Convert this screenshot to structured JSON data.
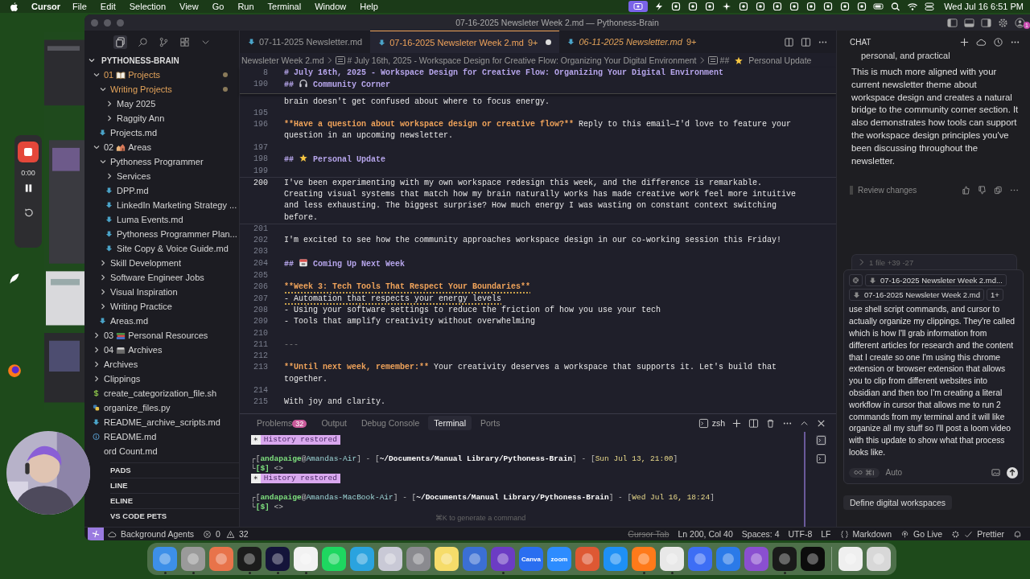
{
  "menu_bar": {
    "app": "Cursor",
    "items": [
      "File",
      "Edit",
      "Selection",
      "View",
      "Go",
      "Run",
      "Terminal",
      "Window",
      "Help"
    ],
    "clock": "Wed Jul 16  6:51 PM"
  },
  "recorder": {
    "time": "0:00"
  },
  "window": {
    "title": "07-16-2025 Newsleter Week 2.md — Pythoness-Brain",
    "notifications": "1"
  },
  "tabs": [
    {
      "label": "07-11-2025 Newsletter.md",
      "selected": false,
      "preview": false,
      "dirty": false
    },
    {
      "label": "07-16-2025 Newsleter Week 2.md",
      "selected": true,
      "preview": false,
      "problems": "9+",
      "dirty": true
    },
    {
      "label": "06-11-2025 Newsletter.md",
      "selected": false,
      "preview": true,
      "problems": "9+",
      "dirty": false
    }
  ],
  "explorer": {
    "title": "PYTHONESS-BRAIN",
    "tree": [
      {
        "kind": "folder",
        "prefix": "01",
        "emblem": {
          "kind": "book"
        },
        "label": "Projects",
        "expanded": true,
        "modified": true,
        "children": [
          {
            "kind": "folder",
            "label": "Writing Projects",
            "expanded": true,
            "modified": true,
            "children": [
              {
                "kind": "folder",
                "label": "May 2025",
                "expanded": false,
                "modified": false
              },
              {
                "kind": "folder",
                "label": "Raggity Ann",
                "expanded": false,
                "modified": false
              }
            ]
          },
          {
            "kind": "md",
            "label": "Projects.md",
            "modified": false
          }
        ]
      },
      {
        "kind": "folder",
        "prefix": "02",
        "emblem": {
          "kind": "houses"
        },
        "label": "Areas",
        "expanded": true,
        "modified": false,
        "children": [
          {
            "kind": "folder",
            "label": "Pythoness Programmer",
            "expanded": true,
            "modified": false,
            "children": [
              {
                "kind": "folder",
                "label": "Services",
                "expanded": false,
                "modified": false
              },
              {
                "kind": "md",
                "label": "DPP.md",
                "modified": false
              },
              {
                "kind": "md",
                "label": "LinkedIn Marketing Strategy ...",
                "modified": false
              },
              {
                "kind": "md",
                "label": "Luma Events.md",
                "modified": false
              },
              {
                "kind": "md",
                "label": "Pythoness Programmer Plan...",
                "modified": false
              },
              {
                "kind": "md",
                "label": "Site Copy & Voice Guide.md",
                "modified": false
              }
            ]
          },
          {
            "kind": "folder",
            "label": "Skill Development",
            "expanded": false,
            "modified": false
          },
          {
            "kind": "folder",
            "label": "Software Engineer Jobs",
            "expanded": false,
            "modified": false
          },
          {
            "kind": "folder",
            "label": "Visual Inspiration",
            "expanded": false,
            "modified": false
          },
          {
            "kind": "folder",
            "label": "Writing Practice",
            "expanded": false,
            "modified": false
          },
          {
            "kind": "md",
            "label": "Areas.md",
            "modified": false
          }
        ]
      },
      {
        "kind": "folder",
        "prefix": "03",
        "emblem": {
          "kind": "books"
        },
        "label": "Personal Resources",
        "expanded": false,
        "modified": false
      },
      {
        "kind": "folder",
        "prefix": "04",
        "emblem": {
          "kind": "cardbox"
        },
        "label": "Archives",
        "expanded": false,
        "modified": false
      },
      {
        "kind": "folder",
        "label": "Archives",
        "expanded": false,
        "modified": false
      },
      {
        "kind": "folder",
        "label": "Clippings",
        "expanded": false,
        "modified": false
      },
      {
        "kind": "sh",
        "label": "create_categorization_file.sh",
        "modified": false
      },
      {
        "kind": "py",
        "label": "organize_files.py",
        "modified": false
      },
      {
        "kind": "md",
        "label": "README_archive_scripts.md",
        "modified": false
      },
      {
        "kind": "info",
        "label": "README.md",
        "modified": false
      },
      {
        "kind": "plain",
        "label": "ord Count.md",
        "modified": false
      }
    ]
  },
  "sidebar_panels": [
    "PADS",
    "LINE",
    "ELINE",
    "VS CODE PETS"
  ],
  "breadcrumb": [
    {
      "kind": "file",
      "text": "Newsleter Week 2.md"
    },
    {
      "kind": "symbol",
      "text": "# July 16th, 2025 - Workspace Design for Creative Flow: Organizing Your Digital Environment"
    },
    {
      "kind": "symbol",
      "prefix": "##",
      "emblem": {
        "kind": "star"
      },
      "text": "Personal Update"
    }
  ],
  "editor": {
    "sticky": [
      {
        "number": "8",
        "segments": [
          {
            "kind": "heading",
            "text": "# July 16th, 2025 - Workspace Design for Creative Flow: Organizing Your Digital Environment"
          }
        ]
      },
      {
        "number": "190",
        "segments": [
          {
            "kind": "heading",
            "text": "##"
          },
          {
            "kind": "headphones"
          },
          {
            "kind": "heading",
            "text": "Community Corner"
          }
        ]
      }
    ],
    "lines": [
      {
        "current": false,
        "squiggle": false,
        "segments": [
          {
            "kind": "text",
            "text": "brain doesn't get confused about where to focus energy."
          }
        ]
      },
      {
        "number": "195",
        "current": false
      },
      {
        "number": "196",
        "current": false,
        "squiggle": false,
        "segments": [
          {
            "kind": "bold",
            "text": "**Have a question about workspace design or creative flow?**"
          },
          {
            "kind": "text",
            "text": " Reply to this email—I'd love to feature your question in an upcoming newsletter."
          }
        ]
      },
      {
        "number": "197",
        "current": false
      },
      {
        "number": "198",
        "current": false,
        "squiggle": false,
        "segments": [
          {
            "kind": "heading",
            "text": "##"
          },
          {
            "kind": "star"
          },
          {
            "kind": "heading",
            "text": "Personal Update"
          }
        ]
      },
      {
        "number": "199",
        "current": false
      },
      {
        "number": "200",
        "current": true,
        "squiggle": false,
        "segments": [
          {
            "kind": "text",
            "text": "I've been experimenting with my own workspace redesign this week, and the difference is remarkable. Creating visual systems that match how my brain naturally works has made creative work feel more intuitive and less exhausting. The biggest surprise? How much energy I was wasting on constant context switching before."
          }
        ]
      },
      {
        "number": "201",
        "current": false
      },
      {
        "number": "202",
        "current": false,
        "squiggle": false,
        "segments": [
          {
            "kind": "text",
            "text": "I'm excited to see how the community approaches workspace design in our co-working session this Friday!"
          }
        ]
      },
      {
        "number": "203",
        "current": false
      },
      {
        "number": "204",
        "current": false,
        "squiggle": false,
        "segments": [
          {
            "kind": "heading",
            "text": "##"
          },
          {
            "kind": "calendar"
          },
          {
            "kind": "heading",
            "text": "Coming Up Next Week"
          }
        ]
      },
      {
        "number": "205",
        "current": false
      },
      {
        "number": "206",
        "current": false,
        "squiggle": true,
        "segments": [
          {
            "kind": "bold",
            "text": "**Week 3: Tech Tools That Respect Your Boundaries**"
          }
        ]
      },
      {
        "number": "207",
        "current": false,
        "squiggle": true,
        "segments": [
          {
            "kind": "text",
            "text": "- Automation that respects your energy levels"
          }
        ]
      },
      {
        "number": "208",
        "current": false,
        "squiggle": false,
        "segments": [
          {
            "kind": "text",
            "text": "- Using your software settings to reduce the friction of how you use your tech"
          }
        ]
      },
      {
        "number": "209",
        "current": false,
        "squiggle": false,
        "segments": [
          {
            "kind": "text",
            "text": "- Tools that amplify creativity without overwhelming"
          }
        ]
      },
      {
        "number": "210",
        "current": false
      },
      {
        "number": "211",
        "current": false,
        "squiggle": false,
        "segments": [
          {
            "kind": "rule",
            "text": "---"
          }
        ]
      },
      {
        "number": "212",
        "current": false
      },
      {
        "number": "213",
        "current": false,
        "squiggle": false,
        "segments": [
          {
            "kind": "bold",
            "text": "**Until next week, remember:**"
          },
          {
            "kind": "text",
            "text": " Your creativity deserves a workspace that supports it. Let's build that together."
          }
        ]
      },
      {
        "number": "214",
        "current": false
      },
      {
        "number": "215",
        "current": false,
        "squiggle": false,
        "segments": [
          {
            "kind": "text",
            "text": "With joy and clarity."
          }
        ]
      }
    ]
  },
  "panel": {
    "tabs": [
      {
        "label": "Problems",
        "badge": "32",
        "selected": false
      },
      {
        "label": "Output",
        "selected": false
      },
      {
        "label": "Debug Console",
        "selected": false
      },
      {
        "label": "Terminal",
        "selected": true
      },
      {
        "label": "Ports",
        "selected": false
      }
    ],
    "shell": "zsh",
    "sessions": [
      {
        "marker": "∗",
        "notice": "History restored",
        "prompt": [
          {
            "kind": "punct",
            "text": "┌["
          },
          {
            "kind": "user",
            "text": "andapaige"
          },
          {
            "kind": "punct",
            "text": "@"
          },
          {
            "kind": "host",
            "text": "Amandas-Air"
          },
          {
            "kind": "punct",
            "text": "] - ["
          },
          {
            "kind": "path",
            "text": "~/Documents/Manual Library/Pythoness-Brain"
          },
          {
            "kind": "punct",
            "text": "] - ["
          },
          {
            "kind": "date",
            "text": "Sun Jul 13, 21:00"
          },
          {
            "kind": "punct",
            "text": "]"
          }
        ],
        "input": [
          {
            "kind": "punct",
            "text": "└"
          },
          {
            "kind": "user",
            "text": "[$]"
          },
          {
            "kind": "punct",
            "text": " <>"
          }
        ]
      },
      {
        "marker": "∗",
        "notice": "History restored",
        "prompt": [
          {
            "kind": "punct",
            "text": "┌["
          },
          {
            "kind": "user",
            "text": "andapaige"
          },
          {
            "kind": "punct",
            "text": "@"
          },
          {
            "kind": "host",
            "text": "Amandas-MacBook-Air"
          },
          {
            "kind": "punct",
            "text": "] - ["
          },
          {
            "kind": "path",
            "text": "~/Documents/Manual Library/Pythoness-Brain"
          },
          {
            "kind": "punct",
            "text": "] - ["
          },
          {
            "kind": "date",
            "text": "Wed Jul 16, 18:24"
          },
          {
            "kind": "punct",
            "text": "]"
          }
        ],
        "input": [
          {
            "kind": "punct",
            "text": "└"
          },
          {
            "kind": "user",
            "text": "[$]"
          },
          {
            "kind": "punct",
            "text": " <>"
          }
        ]
      }
    ],
    "hint": "⌘K to generate a command"
  },
  "chat": {
    "title": "CHAT",
    "continuation": "personal, and practical",
    "message": "This is much more aligned with your current newsletter theme about workspace design and creates a natural bridge to the community corner section. It also demonstrates how tools can support the workspace design principles you've been discussing throughout the newsletter.",
    "review": "Review changes",
    "changes": {
      "expanded": false,
      "summary": "1 file",
      "added": "+39",
      "removed": "-27"
    },
    "composer": {
      "chips": [
        "07-16-2025 Newsleter Week 2.md...",
        "07-16-2025 Newsleter Week 2.md"
      ],
      "more": "1+",
      "text": "use shell script commands, and cursor to actually organize my clippings. They're called which is how I'll grab information from different articles for research and the content that I create so one I'm using this chrome extension or browser extension that allows you to clip from different websites into obsidian and then too I'm creating a literal workflow in cursor that allows me to run 2 commands from my terminal and it will like organize all my stuff so I'll post a loom video with this update to show what that process looks like.",
      "mode": "⌘I",
      "model": "Auto"
    },
    "suggestion": "Define digital workspaces"
  },
  "status_bar": {
    "agents": "Background Agents",
    "errors": "0",
    "warnings": "32",
    "cursor_tab": {
      "text": "Cursor Tab",
      "disabled": true
    },
    "position": "Ln 200, Col 40",
    "spaces": "Spaces: 4",
    "encoding": "UTF-8",
    "eol": "LF",
    "language": "Markdown",
    "live": "Go Live",
    "formatter": "Prettier"
  },
  "dock": [
    {
      "color": "#3d8fe8",
      "running": true
    },
    {
      "color": "#9a9a9a",
      "running": true
    },
    {
      "color": "#e8734a",
      "running": false
    },
    {
      "color": "#1c1c1c",
      "running": true
    },
    {
      "color": "#14143a",
      "running": true
    },
    {
      "color": "#f2f2f2",
      "running": true
    },
    {
      "color": "#1ed760",
      "running": false
    },
    {
      "color": "#2aa3df",
      "running": false
    },
    {
      "color": "#c9c9d6",
      "running": false
    },
    {
      "color": "#8a8a8f",
      "running": false
    },
    {
      "color": "#f6dc6a",
      "running": false
    },
    {
      "color": "#3b6fd4",
      "running": false
    },
    {
      "color": "#6c3cc4",
      "running": true
    },
    {
      "color": "#2a6ef0",
      "running": false,
      "label": "Canva"
    },
    {
      "color": "#2d8cff",
      "running": false,
      "label": "zoom"
    },
    {
      "color": "#de5833",
      "running": false
    },
    {
      "color": "#1e90f5",
      "running": false
    },
    {
      "color": "#ff7a1a",
      "running": true
    },
    {
      "color": "#e8e8e8",
      "running": true
    },
    {
      "color": "#3d6ef5",
      "running": false
    },
    {
      "color": "#2b7ae8",
      "running": false
    },
    {
      "color": "#8a4fd0",
      "running": false
    },
    {
      "color": "#1a1a1a",
      "running": true
    },
    {
      "color": "#0c0c0c",
      "running": false
    },
    {
      "color": "#efefef",
      "running": false
    },
    {
      "color": "#d8d8d8",
      "running": false
    }
  ]
}
